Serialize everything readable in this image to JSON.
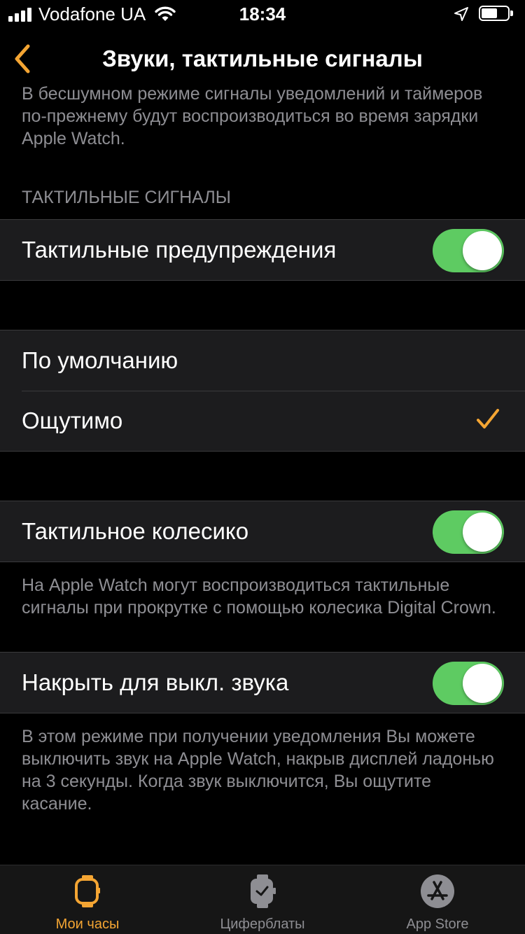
{
  "status_bar": {
    "carrier": "Vodafone UA",
    "time": "18:34"
  },
  "nav": {
    "title": "Звуки, тактильные сигналы"
  },
  "top_footer": "В бесшумном режиме сигналы уведомлений и таймеров по-прежнему будут воспроизводиться во время зарядки Apple Watch.",
  "haptics_section": {
    "header": "Тактильные сигналы",
    "haptic_alerts": {
      "label": "Тактильные предупреждения",
      "on": true
    }
  },
  "haptic_strength": {
    "options": [
      {
        "label": "По умолчанию",
        "selected": false
      },
      {
        "label": "Ощутимо",
        "selected": true
      }
    ]
  },
  "crown_haptics": {
    "label": "Тактильное колесико",
    "on": true,
    "footer": "На Apple Watch могут воспроизводиться тактильные сигналы при прокрутке с помощью колесика Digital Crown."
  },
  "cover_to_mute": {
    "label": "Накрыть для выкл. звука",
    "on": true,
    "footer": "В этом режиме при получении уведомления Вы можете выключить звук на Apple Watch, накрыв дисплей ладонью на 3 секунды. Когда звук выключится, Вы ощутите касание."
  },
  "tab_bar": {
    "tabs": [
      {
        "label": "Мои часы",
        "icon": "watch-icon",
        "active": true
      },
      {
        "label": "Циферблаты",
        "icon": "watch-face-icon",
        "active": false
      },
      {
        "label": "App Store",
        "icon": "app-store-icon",
        "active": false
      }
    ]
  },
  "colors": {
    "accent": "#f4a533",
    "toggle_on": "#5ecb62",
    "cell_bg": "#1c1c1e",
    "secondary_text": "#8e8e93",
    "inactive_tab": "#8e8e93"
  }
}
